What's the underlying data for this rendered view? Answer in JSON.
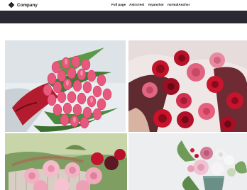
{
  "brand": {
    "name": "Company",
    "icon": "flower-logo-icon"
  },
  "nav": [
    {
      "label": "Full page"
    },
    {
      "label": "Astra test"
    },
    {
      "label": "myanchor"
    },
    {
      "label": "normalAnchor"
    }
  ],
  "colors": {
    "hero_band": "#2a2933",
    "background": "#ffffff",
    "accent_pink": "#e0567a",
    "accent_red": "#b3122c"
  },
  "gallery": [
    {
      "photo": "pink-tulip-bouquet"
    },
    {
      "photo": "red-rose-bouquet"
    },
    {
      "photo": "pink-rose-basket"
    },
    {
      "photo": "mixed-flowers-vase"
    }
  ]
}
